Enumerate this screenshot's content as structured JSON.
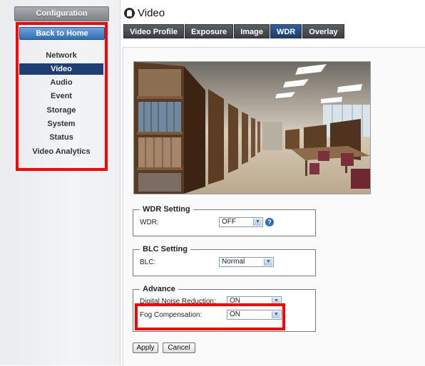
{
  "sidebar": {
    "config_label": "Configuration",
    "home_label": "Back to Home",
    "items": [
      {
        "label": "Network",
        "active": false
      },
      {
        "label": "Video",
        "active": true
      },
      {
        "label": "Audio",
        "active": false
      },
      {
        "label": "Event",
        "active": false
      },
      {
        "label": "Storage",
        "active": false
      },
      {
        "label": "System",
        "active": false
      },
      {
        "label": "Status",
        "active": false
      },
      {
        "label": "Video Analytics",
        "active": false
      }
    ]
  },
  "header": {
    "title": "Video",
    "icon": "video-camera-icon",
    "tabs": [
      {
        "label": "Video Profile",
        "active": false
      },
      {
        "label": "Exposure",
        "active": false
      },
      {
        "label": "Image",
        "active": false
      },
      {
        "label": "WDR",
        "active": true
      },
      {
        "label": "Overlay",
        "active": false
      }
    ]
  },
  "wdr": {
    "legend": "WDR Setting",
    "label": "WDR:",
    "value": "OFF"
  },
  "blc": {
    "legend": "BLC Setting",
    "label": "BLC:",
    "value": "Normal"
  },
  "advance": {
    "legend": "Advance",
    "dnr_label": "Digital Noise Reduction:",
    "dnr_value": "ON",
    "fog_label": "Fog Compensation:",
    "fog_value": "ON"
  },
  "buttons": {
    "apply": "Apply",
    "cancel": "Cancel"
  },
  "colors": {
    "highlight": "#ff0000",
    "active_tab": "#1b3d6e"
  }
}
